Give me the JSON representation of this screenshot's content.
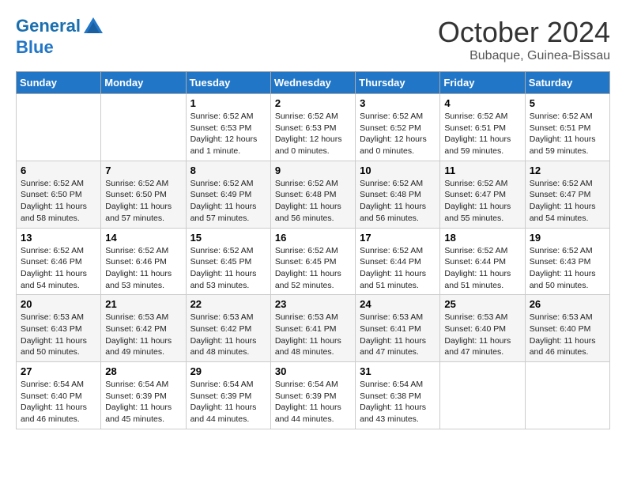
{
  "logo": {
    "line1": "General",
    "line2": "Blue"
  },
  "title": "October 2024",
  "subtitle": "Bubaque, Guinea-Bissau",
  "days_header": [
    "Sunday",
    "Monday",
    "Tuesday",
    "Wednesday",
    "Thursday",
    "Friday",
    "Saturday"
  ],
  "weeks": [
    [
      {
        "day": "",
        "info": ""
      },
      {
        "day": "",
        "info": ""
      },
      {
        "day": "1",
        "info": "Sunrise: 6:52 AM\nSunset: 6:53 PM\nDaylight: 12 hours\nand 1 minute."
      },
      {
        "day": "2",
        "info": "Sunrise: 6:52 AM\nSunset: 6:53 PM\nDaylight: 12 hours\nand 0 minutes."
      },
      {
        "day": "3",
        "info": "Sunrise: 6:52 AM\nSunset: 6:52 PM\nDaylight: 12 hours\nand 0 minutes."
      },
      {
        "day": "4",
        "info": "Sunrise: 6:52 AM\nSunset: 6:51 PM\nDaylight: 11 hours\nand 59 minutes."
      },
      {
        "day": "5",
        "info": "Sunrise: 6:52 AM\nSunset: 6:51 PM\nDaylight: 11 hours\nand 59 minutes."
      }
    ],
    [
      {
        "day": "6",
        "info": "Sunrise: 6:52 AM\nSunset: 6:50 PM\nDaylight: 11 hours\nand 58 minutes."
      },
      {
        "day": "7",
        "info": "Sunrise: 6:52 AM\nSunset: 6:50 PM\nDaylight: 11 hours\nand 57 minutes."
      },
      {
        "day": "8",
        "info": "Sunrise: 6:52 AM\nSunset: 6:49 PM\nDaylight: 11 hours\nand 57 minutes."
      },
      {
        "day": "9",
        "info": "Sunrise: 6:52 AM\nSunset: 6:48 PM\nDaylight: 11 hours\nand 56 minutes."
      },
      {
        "day": "10",
        "info": "Sunrise: 6:52 AM\nSunset: 6:48 PM\nDaylight: 11 hours\nand 56 minutes."
      },
      {
        "day": "11",
        "info": "Sunrise: 6:52 AM\nSunset: 6:47 PM\nDaylight: 11 hours\nand 55 minutes."
      },
      {
        "day": "12",
        "info": "Sunrise: 6:52 AM\nSunset: 6:47 PM\nDaylight: 11 hours\nand 54 minutes."
      }
    ],
    [
      {
        "day": "13",
        "info": "Sunrise: 6:52 AM\nSunset: 6:46 PM\nDaylight: 11 hours\nand 54 minutes."
      },
      {
        "day": "14",
        "info": "Sunrise: 6:52 AM\nSunset: 6:46 PM\nDaylight: 11 hours\nand 53 minutes."
      },
      {
        "day": "15",
        "info": "Sunrise: 6:52 AM\nSunset: 6:45 PM\nDaylight: 11 hours\nand 53 minutes."
      },
      {
        "day": "16",
        "info": "Sunrise: 6:52 AM\nSunset: 6:45 PM\nDaylight: 11 hours\nand 52 minutes."
      },
      {
        "day": "17",
        "info": "Sunrise: 6:52 AM\nSunset: 6:44 PM\nDaylight: 11 hours\nand 51 minutes."
      },
      {
        "day": "18",
        "info": "Sunrise: 6:52 AM\nSunset: 6:44 PM\nDaylight: 11 hours\nand 51 minutes."
      },
      {
        "day": "19",
        "info": "Sunrise: 6:52 AM\nSunset: 6:43 PM\nDaylight: 11 hours\nand 50 minutes."
      }
    ],
    [
      {
        "day": "20",
        "info": "Sunrise: 6:53 AM\nSunset: 6:43 PM\nDaylight: 11 hours\nand 50 minutes."
      },
      {
        "day": "21",
        "info": "Sunrise: 6:53 AM\nSunset: 6:42 PM\nDaylight: 11 hours\nand 49 minutes."
      },
      {
        "day": "22",
        "info": "Sunrise: 6:53 AM\nSunset: 6:42 PM\nDaylight: 11 hours\nand 48 minutes."
      },
      {
        "day": "23",
        "info": "Sunrise: 6:53 AM\nSunset: 6:41 PM\nDaylight: 11 hours\nand 48 minutes."
      },
      {
        "day": "24",
        "info": "Sunrise: 6:53 AM\nSunset: 6:41 PM\nDaylight: 11 hours\nand 47 minutes."
      },
      {
        "day": "25",
        "info": "Sunrise: 6:53 AM\nSunset: 6:40 PM\nDaylight: 11 hours\nand 47 minutes."
      },
      {
        "day": "26",
        "info": "Sunrise: 6:53 AM\nSunset: 6:40 PM\nDaylight: 11 hours\nand 46 minutes."
      }
    ],
    [
      {
        "day": "27",
        "info": "Sunrise: 6:54 AM\nSunset: 6:40 PM\nDaylight: 11 hours\nand 46 minutes."
      },
      {
        "day": "28",
        "info": "Sunrise: 6:54 AM\nSunset: 6:39 PM\nDaylight: 11 hours\nand 45 minutes."
      },
      {
        "day": "29",
        "info": "Sunrise: 6:54 AM\nSunset: 6:39 PM\nDaylight: 11 hours\nand 44 minutes."
      },
      {
        "day": "30",
        "info": "Sunrise: 6:54 AM\nSunset: 6:39 PM\nDaylight: 11 hours\nand 44 minutes."
      },
      {
        "day": "31",
        "info": "Sunrise: 6:54 AM\nSunset: 6:38 PM\nDaylight: 11 hours\nand 43 minutes."
      },
      {
        "day": "",
        "info": ""
      },
      {
        "day": "",
        "info": ""
      }
    ]
  ]
}
